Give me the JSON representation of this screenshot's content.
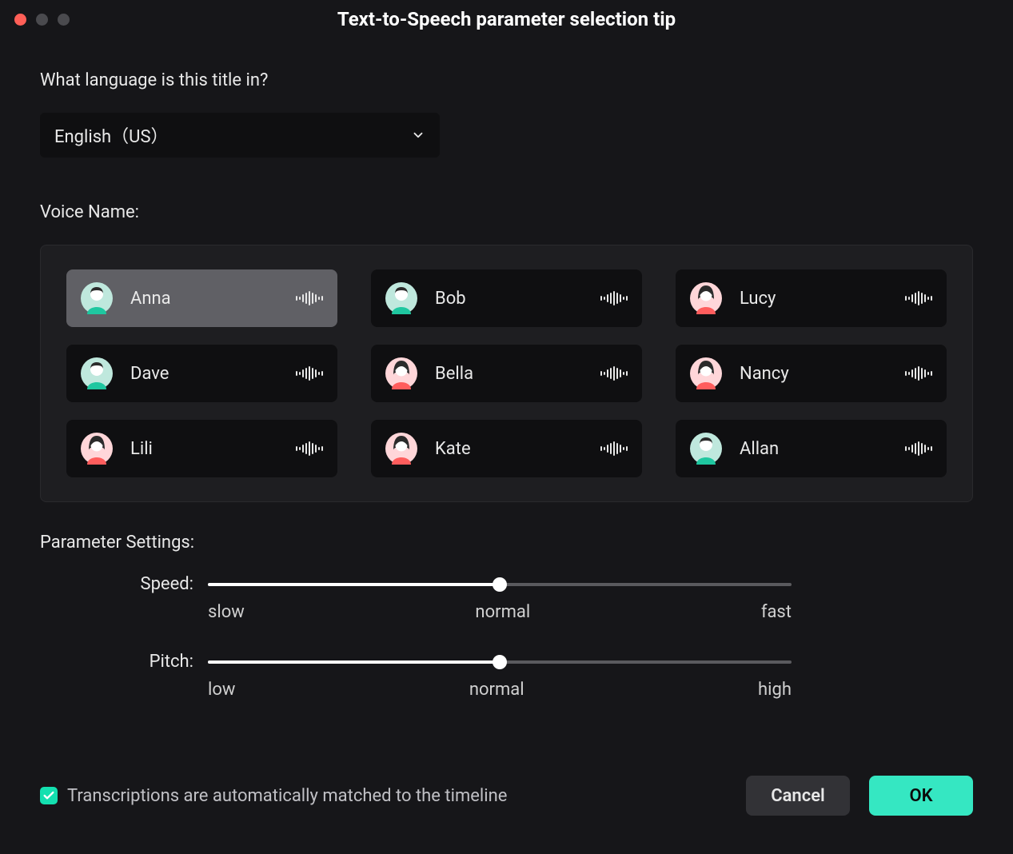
{
  "window": {
    "title": "Text-to-Speech parameter selection tip"
  },
  "language": {
    "label": "What language is this title in?",
    "selected": "English（US）"
  },
  "voices": {
    "label": "Voice Name:",
    "items": [
      {
        "name": "Anna",
        "gender": "male-teal",
        "selected": true
      },
      {
        "name": "Bob",
        "gender": "male-teal",
        "selected": false
      },
      {
        "name": "Lucy",
        "gender": "female-pink",
        "selected": false
      },
      {
        "name": "Dave",
        "gender": "male-teal",
        "selected": false
      },
      {
        "name": "Bella",
        "gender": "female-pink",
        "selected": false
      },
      {
        "name": "Nancy",
        "gender": "female-pink",
        "selected": false
      },
      {
        "name": "Lili",
        "gender": "female-pink",
        "selected": false
      },
      {
        "name": "Kate",
        "gender": "female-pink",
        "selected": false
      },
      {
        "name": "Allan",
        "gender": "male-teal",
        "selected": false
      }
    ]
  },
  "parameters": {
    "label": "Parameter Settings:",
    "speed": {
      "label": "Speed:",
      "ticks": {
        "low": "slow",
        "mid": "normal",
        "high": "fast"
      },
      "value_percent": 50
    },
    "pitch": {
      "label": "Pitch:",
      "ticks": {
        "low": "low",
        "mid": "normal",
        "high": "high"
      },
      "value_percent": 50
    }
  },
  "footer": {
    "auto_match_label": "Transcriptions are automatically matched to the timeline",
    "auto_match_checked": true,
    "cancel": "Cancel",
    "ok": "OK"
  }
}
